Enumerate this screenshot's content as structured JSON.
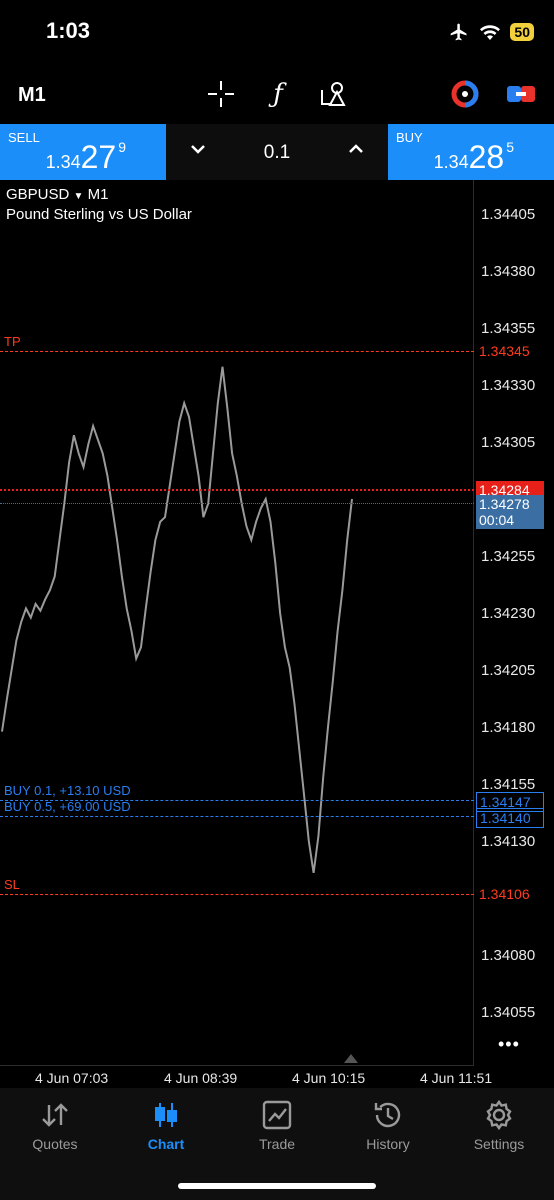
{
  "status_bar": {
    "time": "1:03",
    "battery": "50"
  },
  "toolbar": {
    "timeframe": "M1"
  },
  "order_panel": {
    "sell": {
      "label": "SELL",
      "price_prefix": "1.34",
      "price_big": "27",
      "price_sup": "9"
    },
    "buy": {
      "label": "BUY",
      "price_prefix": "1.34",
      "price_big": "28",
      "price_sup": "5"
    },
    "volume": "0.1"
  },
  "chart": {
    "symbol": "GBPUSD",
    "timeframe": "M1",
    "description": "Pound Sterling vs US Dollar",
    "price_axis": [
      "1.34405",
      "1.34380",
      "1.34355",
      "1.34330",
      "1.34305",
      "1.34255",
      "1.34230",
      "1.34205",
      "1.34180",
      "1.34155",
      "1.34130",
      "1.34080",
      "1.34055"
    ],
    "time_axis": [
      "4 Jun 07:03",
      "4 Jun 08:39",
      "4 Jun 10:15",
      "4 Jun 11:51"
    ],
    "tp": {
      "label": "TP",
      "price": "1.34345"
    },
    "sl": {
      "label": "SL",
      "price": "1.34106"
    },
    "ask": {
      "price": "1.34284"
    },
    "bid": {
      "price": "1.34278",
      "countdown": "00:04"
    },
    "positions": [
      {
        "label": "BUY 0.1, +13.10 USD",
        "price": "1.34147"
      },
      {
        "label": "BUY 0.5, +69.00 USD",
        "price": "1.34140"
      }
    ],
    "more": "•••",
    "colors": {
      "tp_sl": "#ff3b1f",
      "ask": "#e8201a",
      "position": "#2a7ef0",
      "bid_tag": "#3b6fa3",
      "line": "#9a9a9a"
    }
  },
  "chart_data": {
    "type": "line",
    "series": [
      {
        "values": [
          1.34178,
          1.34192,
          1.34205,
          1.34218,
          1.34226,
          1.34232,
          1.34228,
          1.34234,
          1.34231,
          1.34236,
          1.3424,
          1.34246,
          1.34262,
          1.34278,
          1.34296,
          1.34308,
          1.343,
          1.34294,
          1.34304,
          1.34312,
          1.34306,
          1.343,
          1.3429,
          1.34276,
          1.34262,
          1.34246,
          1.34232,
          1.34222,
          1.3421,
          1.34215,
          1.34232,
          1.34248,
          1.34262,
          1.3427,
          1.34272,
          1.34286,
          1.343,
          1.34314,
          1.34322,
          1.34316,
          1.34303,
          1.3429,
          1.34272,
          1.34278,
          1.343,
          1.34322,
          1.34338,
          1.3432,
          1.343,
          1.3429,
          1.34278,
          1.34268,
          1.34262,
          1.3427,
          1.34276,
          1.3428,
          1.3427,
          1.34252,
          1.3423,
          1.34215,
          1.34206,
          1.3419,
          1.3417,
          1.3415,
          1.3413,
          1.34116,
          1.34132,
          1.34158,
          1.3418,
          1.342,
          1.34222,
          1.3424,
          1.34262,
          1.3428
        ]
      }
    ],
    "x_range": [
      "4 Jun 07:03",
      "4 Jun 11:51"
    ]
  },
  "bottom_nav": [
    {
      "label": "Quotes",
      "icon": "quotes-arrows-icon",
      "active": false
    },
    {
      "label": "Chart",
      "icon": "candlestick-chart-icon",
      "active": true
    },
    {
      "label": "Trade",
      "icon": "trade-chart-icon",
      "active": false
    },
    {
      "label": "History",
      "icon": "history-clock-icon",
      "active": false
    },
    {
      "label": "Settings",
      "icon": "settings-gear-icon",
      "active": false
    }
  ]
}
